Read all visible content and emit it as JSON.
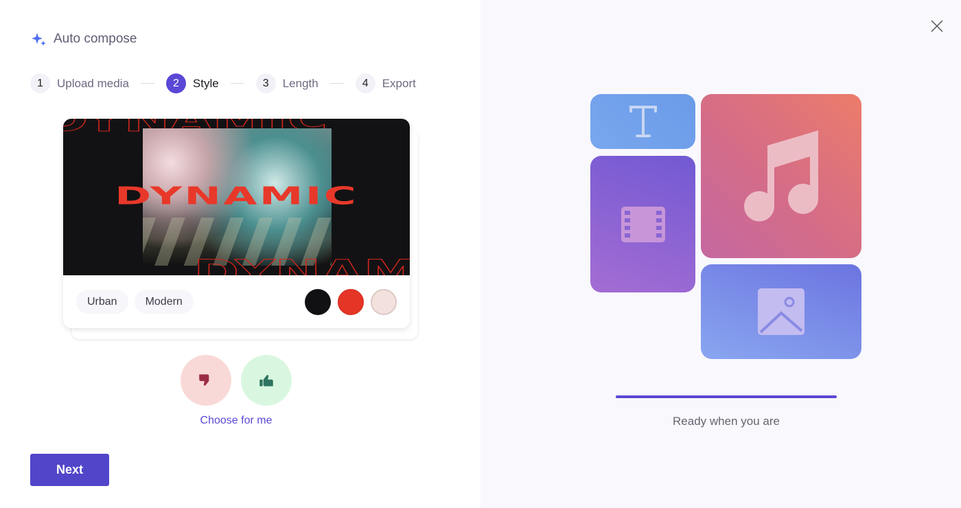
{
  "header": {
    "title": "Auto compose",
    "icon": "sparkle-icon"
  },
  "steps": [
    {
      "number": "1",
      "label": "Upload media",
      "active": false
    },
    {
      "number": "2",
      "label": "Style",
      "active": true
    },
    {
      "number": "3",
      "label": "Length",
      "active": false
    },
    {
      "number": "4",
      "label": "Export",
      "active": false
    }
  ],
  "style_card": {
    "preview_title": "DYNAMIC",
    "tags": [
      "Urban",
      "Modern"
    ],
    "palette": [
      "#111113",
      "#e53526",
      "#f3e1de"
    ]
  },
  "feedback": {
    "dislike_icon": "thumbs-down-icon",
    "like_icon": "thumbs-up-icon",
    "choose_label": "Choose for me"
  },
  "actions": {
    "next_label": "Next"
  },
  "right_panel": {
    "close_icon": "close-icon",
    "tiles": [
      "text-icon",
      "music-icon",
      "film-icon",
      "image-icon"
    ],
    "progress_percent": 100,
    "status": "Ready when you are"
  },
  "colors": {
    "accent": "#5a48d6"
  }
}
